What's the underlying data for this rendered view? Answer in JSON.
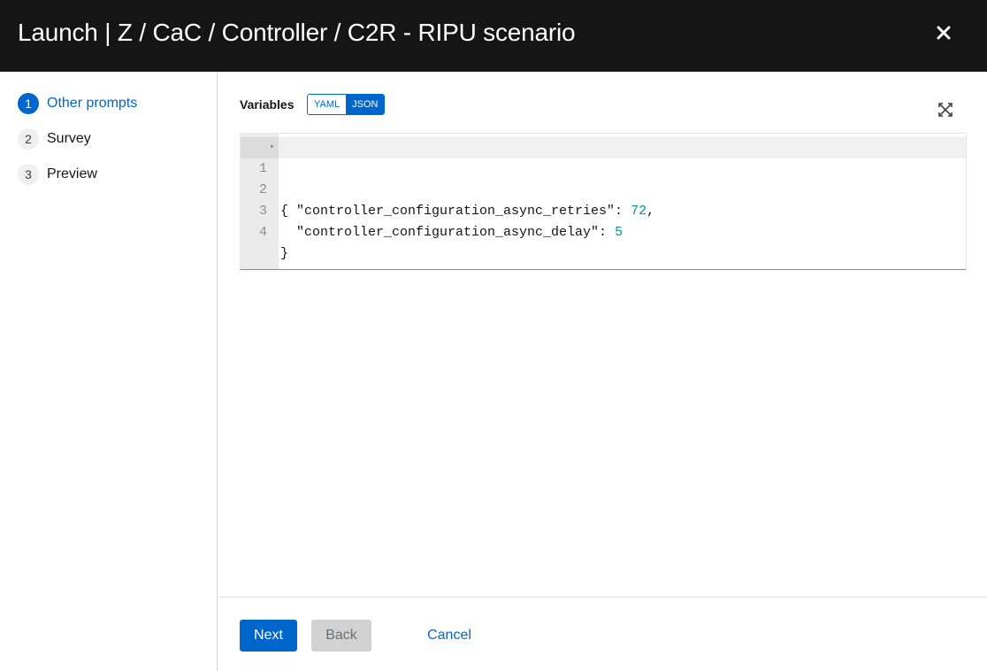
{
  "dialog": {
    "title": "Launch | Z / CaC / Controller / C2R - RIPU scenario",
    "close_icon": "close-icon"
  },
  "steps": [
    {
      "number": "1",
      "label": "Other prompts",
      "active": true
    },
    {
      "number": "2",
      "label": "Survey",
      "active": false
    },
    {
      "number": "3",
      "label": "Preview",
      "active": false
    }
  ],
  "variables": {
    "label": "Variables",
    "format_options": [
      "YAML",
      "JSON"
    ],
    "selected_format": "JSON",
    "expand_icon": "expand-icon"
  },
  "editor": {
    "lines": [
      {
        "n": "1",
        "text": "{"
      },
      {
        "n": "2",
        "key": "  \"controller_configuration_async_retries\": ",
        "value": "72",
        "tail": ","
      },
      {
        "n": "3",
        "key": "  \"controller_configuration_async_delay\": ",
        "value": "5",
        "tail": ""
      },
      {
        "n": "4",
        "text": "}"
      }
    ]
  },
  "footer": {
    "next_label": "Next",
    "back_label": "Back",
    "cancel_label": "Cancel"
  },
  "colors": {
    "header_bg": "#151515",
    "accent": "#0066cc",
    "number_literal": "#009596"
  }
}
